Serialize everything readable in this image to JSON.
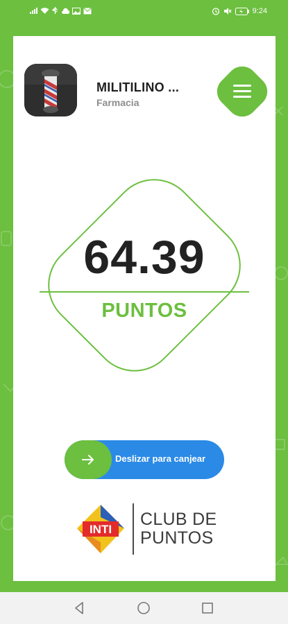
{
  "status_bar": {
    "time": "9:24"
  },
  "store": {
    "name": "MILITILINO ...",
    "category": "Farmacia"
  },
  "points": {
    "value": "64.39",
    "label": "PUNTOS"
  },
  "redeem": {
    "slide_label": "Deslizar para canjear"
  },
  "brand": {
    "logo_text": "INTI",
    "club_line1": "CLUB DE",
    "club_line2": "PUNTOS"
  },
  "colors": {
    "accent": "#6cbf3f",
    "action": "#2b8ae6",
    "logo_red": "#e42b2b"
  },
  "icons": [
    "menu-icon",
    "arrow-right-icon",
    "back-icon",
    "home-icon",
    "recents-icon"
  ]
}
